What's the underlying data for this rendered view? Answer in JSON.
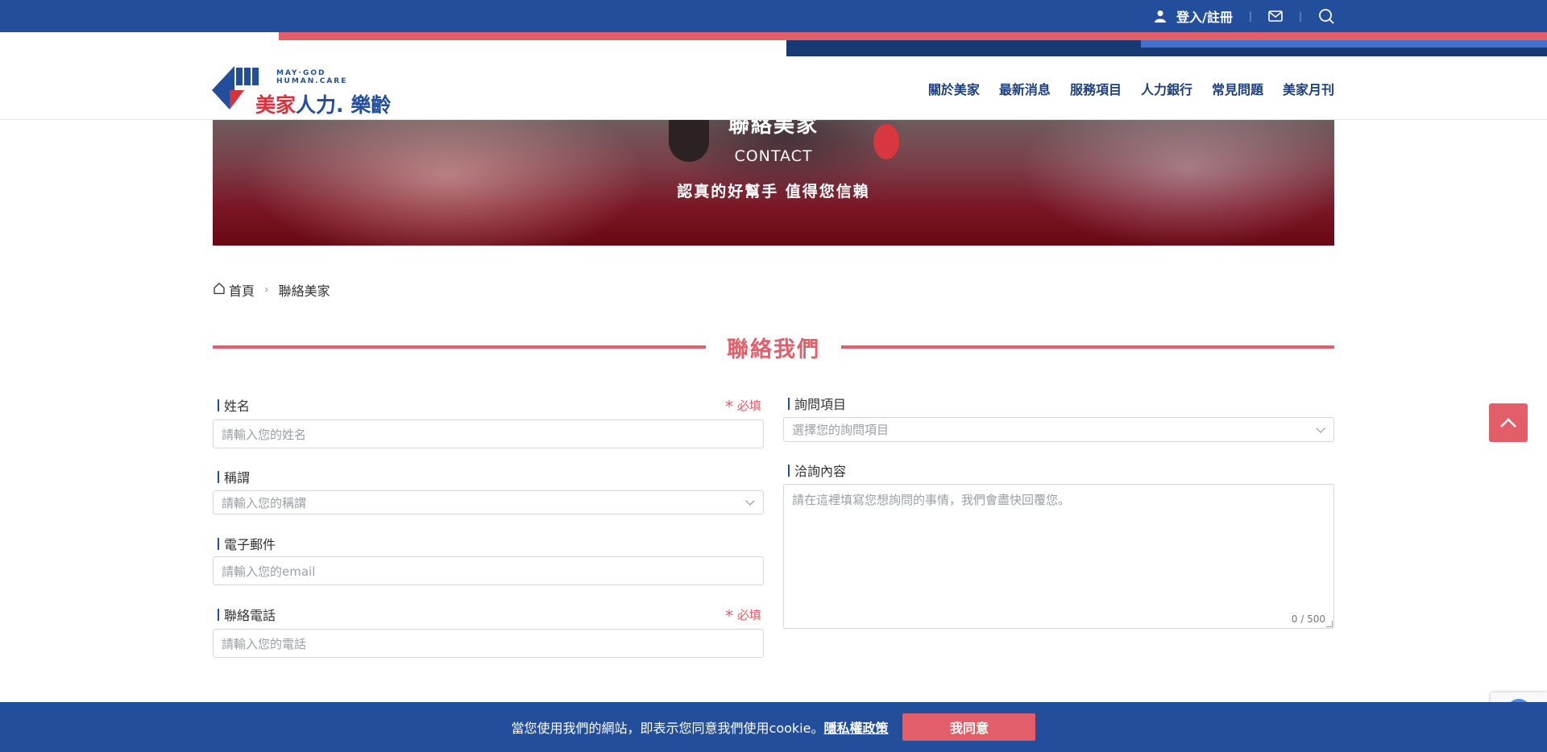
{
  "topbar": {
    "login_label": "登入/註冊",
    "icons": [
      "user-icon",
      "mail-icon",
      "search-icon"
    ]
  },
  "logo": {
    "english_line1": "MAY·GOD",
    "english_line2": "HUMAN.CARE",
    "chinese_red": "美家",
    "chinese_blue": "人力",
    "chinese_tail": ". 樂齡"
  },
  "nav": {
    "items": [
      "關於美家",
      "最新消息",
      "服務項目",
      "人力銀行",
      "常見問題",
      "美家月刊"
    ]
  },
  "hero": {
    "title": "聯絡美家",
    "subtitle": "CONTACT",
    "slogan": "認真的好幫手 值得您信賴"
  },
  "breadcrumb": {
    "home": "首頁",
    "current": "聯絡美家"
  },
  "section": {
    "title": "聯絡我們"
  },
  "form": {
    "required_label": "必填",
    "name": {
      "label": "姓名",
      "placeholder": "請輸入您的姓名"
    },
    "title": {
      "label": "稱謂",
      "placeholder": "請輸入您的稱謂"
    },
    "email": {
      "label": "電子郵件",
      "placeholder": "請輸入您的email"
    },
    "phone": {
      "label": "聯絡電話",
      "placeholder": "請輸入您的電話"
    },
    "inquiry": {
      "label": "詢問項目",
      "placeholder": "選擇您的詢問項目"
    },
    "content": {
      "label": "洽詢內容",
      "placeholder": "請在這裡填寫您想詢問的事情，我們會盡快回覆您。",
      "counter": "0 / 500"
    }
  },
  "cookie": {
    "message": "當您使用我們的網站，即表示您同意我們使用cookie。",
    "policy_link": "隱私權政策",
    "agree_button": "我同意"
  },
  "colors": {
    "brand_blue": "#224e9b",
    "accent_red": "#e25f6a"
  }
}
